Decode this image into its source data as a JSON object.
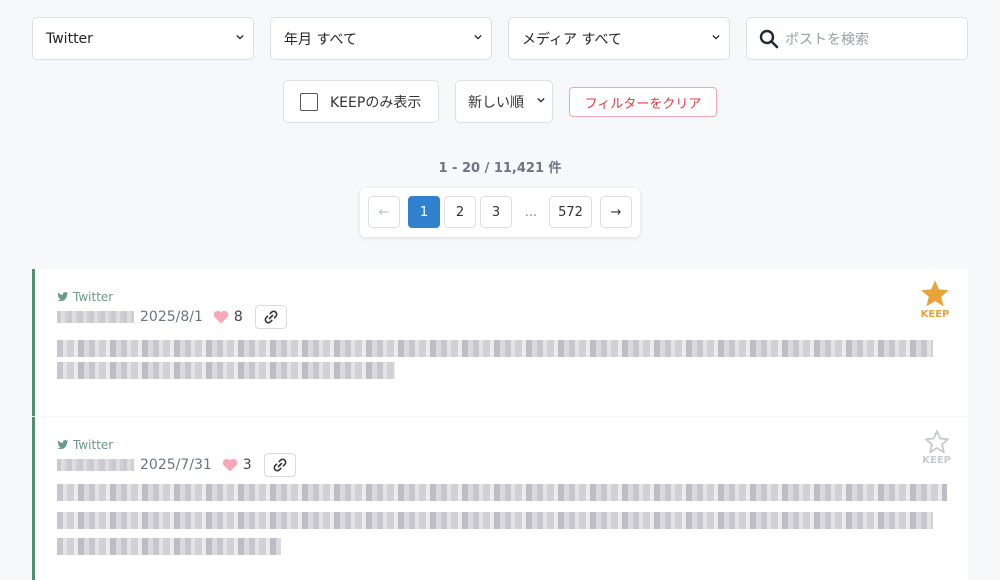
{
  "filters": {
    "platform": "Twitter",
    "date": "年月 すべて",
    "media": "メディア すべて",
    "search_placeholder": "ポストを検索",
    "keep_only_label": "KEEPのみ表示",
    "sort": "新しい順",
    "clear_label": "フィルターをクリア"
  },
  "results": {
    "count_text": "1 - 20 / 11,421 件"
  },
  "pagination": {
    "prev": "←",
    "pages": [
      "1",
      "2",
      "3",
      "572"
    ],
    "ellipsis": "...",
    "next": "→",
    "current": "1"
  },
  "posts": [
    {
      "source": "Twitter",
      "date": "2025/8/1",
      "likes": "8",
      "keep_label": "KEEP",
      "kept": true
    },
    {
      "source": "Twitter",
      "date": "2025/7/31",
      "likes": "3",
      "keep_label": "KEEP",
      "kept": false
    }
  ],
  "colors": {
    "accent": "#3182ce",
    "keep_active": "#e8a33a",
    "keep_inactive": "#c7c9cf",
    "heart": "#f7a8b8",
    "post_border": "#4f8f6f",
    "clear_text": "#e03b45"
  }
}
